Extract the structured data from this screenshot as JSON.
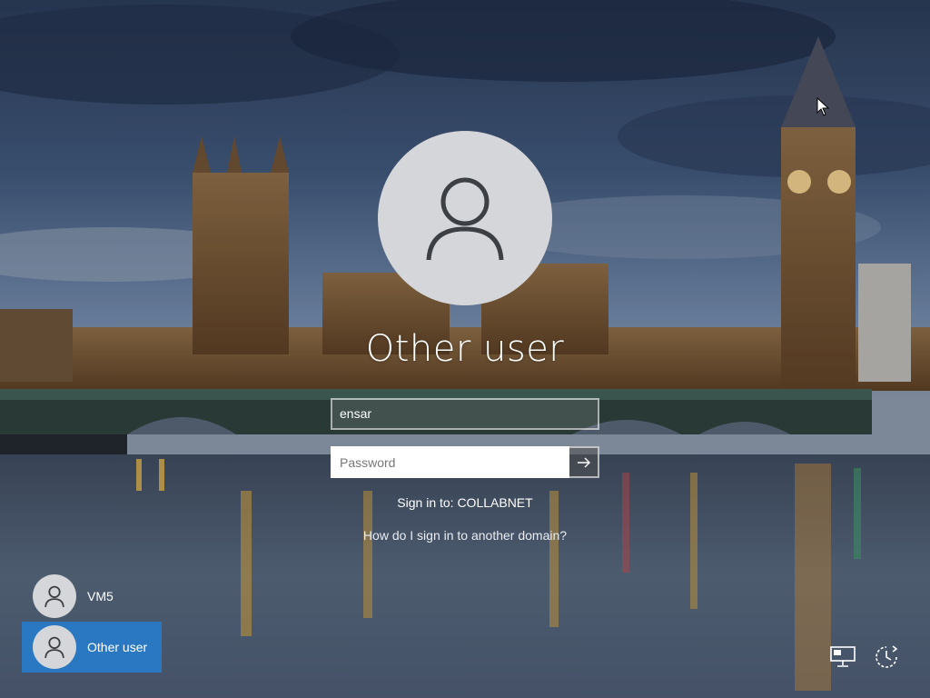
{
  "login": {
    "title": "Other user",
    "username_value": "ensar",
    "password_placeholder": "Password",
    "sign_in_to": "Sign in to: COLLABNET",
    "domain_help_link": "How do I sign in to another domain?"
  },
  "users": [
    {
      "label": "VM5",
      "selected": false
    },
    {
      "label": "Other user",
      "selected": true
    }
  ],
  "corner_icons": [
    "network-icon",
    "ease-of-access-icon"
  ],
  "colors": {
    "selected_tile": "#2b78c2",
    "avatar_bg": "#d4d6d9",
    "avatar_glyph": "#3c3f43"
  }
}
